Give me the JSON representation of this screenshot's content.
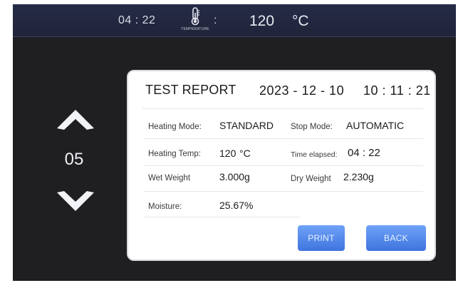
{
  "header": {
    "clock": "04 : 22",
    "thermometer_icon": "thermometer-icon",
    "temperature_caption": "TEMPERATURE",
    "separator": ":",
    "temperature_value": "120",
    "temperature_unit": "°C"
  },
  "pager": {
    "up_icon": "chevron-up-icon",
    "down_icon": "chevron-down-icon",
    "current": "05"
  },
  "report": {
    "title": "TEST REPORT",
    "date": "2023 - 12 - 10",
    "time": "10 : 11 : 21",
    "fields": {
      "heating_mode_label": "Heating Mode:",
      "heating_mode_value": "STANDARD",
      "stop_mode_label": "Stop Mode:",
      "stop_mode_value": "AUTOMATIC",
      "heating_temp_label": "Heating Temp:",
      "heating_temp_value": "120",
      "heating_temp_unit": "°C",
      "time_elapsed_label": "Time elapsed:",
      "time_elapsed_value": "04 : 22",
      "wet_weight_label": "Wet Weight",
      "wet_weight_value": "3.000g",
      "dry_weight_label": "Dry Weight",
      "dry_weight_value": "2.230g",
      "moisture_label": "Moisture:",
      "moisture_value": "25.67%"
    },
    "buttons": {
      "print_label": "PRINT",
      "back_label": "BACK"
    }
  },
  "colors": {
    "topbar": "#252a44",
    "background": "#1f1f22",
    "button": "#4d83ea"
  }
}
